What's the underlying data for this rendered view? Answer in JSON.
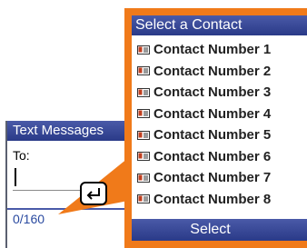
{
  "background_screen": {
    "title": "Text Messages",
    "to_label": "To:",
    "char_counter": "0/160"
  },
  "enter_key": {
    "icon": "enter-arrow-icon"
  },
  "contact_popup": {
    "title": "Select a Contact",
    "contacts": [
      {
        "label": "Contact Number 1",
        "icon": "contact-card-icon"
      },
      {
        "label": "Contact Number 2",
        "icon": "contact-card-icon"
      },
      {
        "label": "Contact Number 3",
        "icon": "contact-card-icon"
      },
      {
        "label": "Contact Number 4",
        "icon": "contact-card-icon"
      },
      {
        "label": "Contact Number 5",
        "icon": "contact-card-icon"
      },
      {
        "label": "Contact Number 6",
        "icon": "contact-card-icon"
      },
      {
        "label": "Contact Number 7",
        "icon": "contact-card-icon"
      },
      {
        "label": "Contact Number 8",
        "icon": "contact-card-icon"
      }
    ],
    "softkey_label": "Select"
  },
  "colors": {
    "accent_orange": "#f07a1a",
    "title_bar_blue": "#3a4a98",
    "counter_blue": "#2a4aa0"
  }
}
